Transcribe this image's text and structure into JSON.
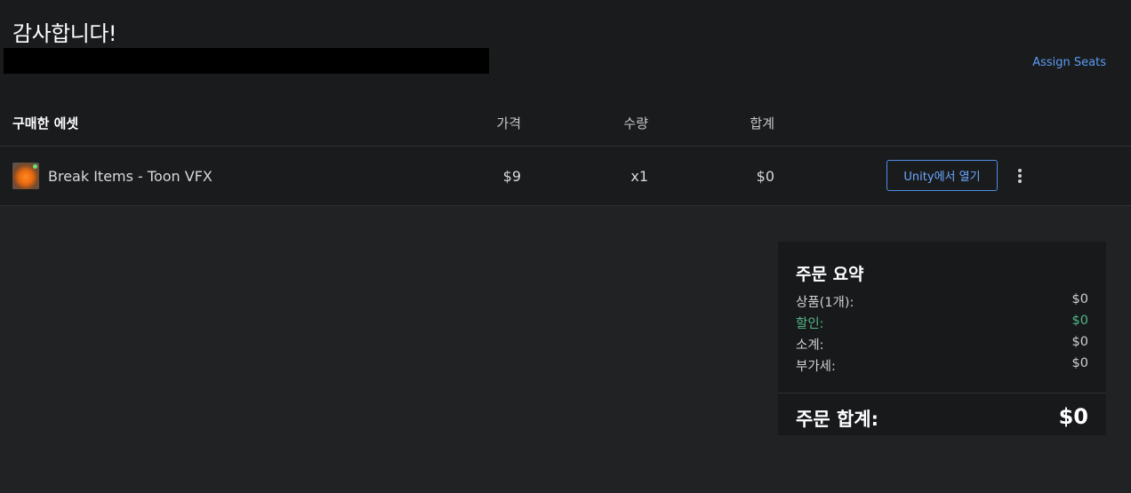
{
  "header": {
    "title": "감사합니다!",
    "assign_seats_label": "Assign Seats"
  },
  "table": {
    "columns": {
      "asset": "구매한 에셋",
      "price": "가격",
      "quantity": "수량",
      "total": "합계"
    },
    "rows": [
      {
        "name": "Break Items - Toon VFX",
        "price": "$9",
        "quantity": "x1",
        "total": "$0",
        "action_label": "Unity에서 열기",
        "thumbnail_icon": "fire-orb-thumbnail"
      }
    ]
  },
  "summary": {
    "title": "주문 요약",
    "items_label": "상품(1개):",
    "items_value": "$0",
    "discount_label": "할인:",
    "discount_value": "$0",
    "subtotal_label": "소계:",
    "subtotal_value": "$0",
    "vat_label": "부가세:",
    "vat_value": "$0",
    "total_label": "주문 합계:",
    "total_value": "$0"
  },
  "colors": {
    "page_bg": "#212224",
    "panel_bg": "#1a1b1d",
    "link": "#5b9cf5",
    "discount": "#52b788"
  }
}
